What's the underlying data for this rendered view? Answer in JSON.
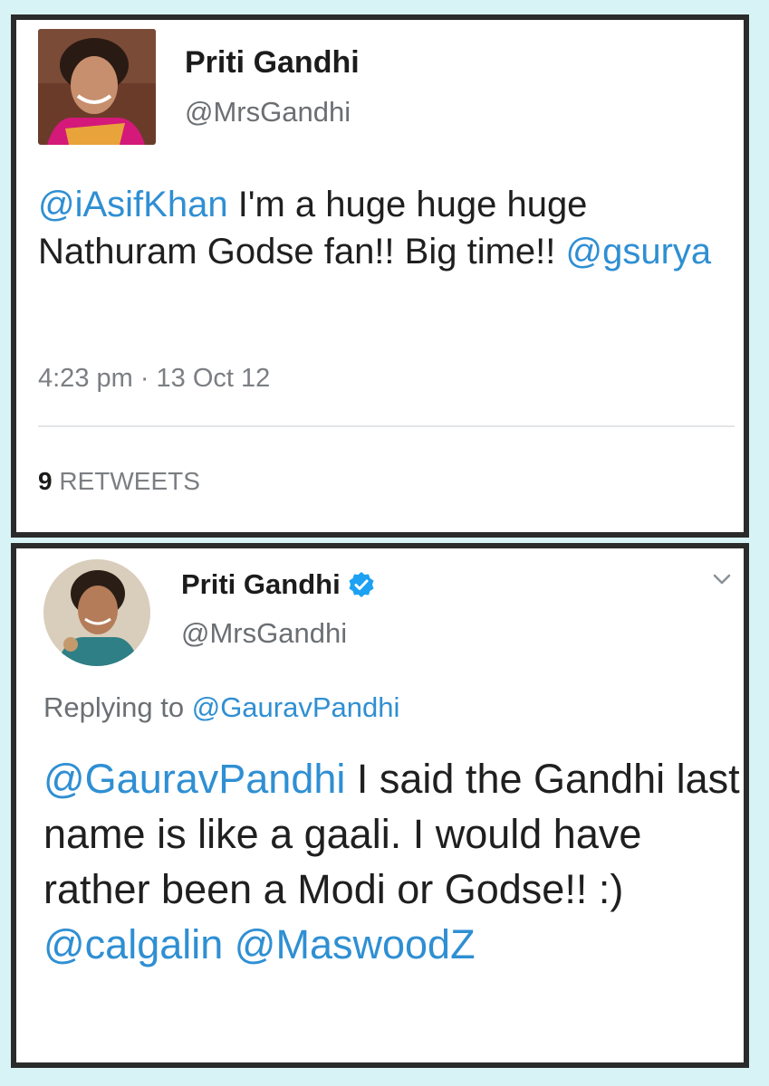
{
  "tweet1": {
    "author_name": "Priti Gandhi",
    "author_handle": "@MrsGandhi",
    "mention_1": "@iAsifKhan",
    "text_main": " I'm a huge huge huge Nathuram Godse fan!! Big time!! ",
    "mention_2": "@gsurya",
    "timestamp": "4:23 pm · 13 Oct 12",
    "retweet_count": "9",
    "retweet_label": " RETWEETS"
  },
  "tweet2": {
    "author_name": "Priti Gandhi",
    "author_handle": "@MrsGandhi",
    "reply_prefix": "Replying to ",
    "reply_to": "@GauravPandhi",
    "mention_1": "@GauravPandhi",
    "text_main": " I said the Gandhi last name is like a gaali. I would have rather been a Modi or Godse!! :) ",
    "mention_2": "@calgalin",
    "mention_3": "@MaswoodZ"
  },
  "colors": {
    "background": "#d8f3f6",
    "mention": "#2f8fd3",
    "verified": "#1da1f2",
    "border": "#2b2b2b"
  },
  "icons": [
    "verified-badge-icon",
    "chevron-down-icon"
  ]
}
